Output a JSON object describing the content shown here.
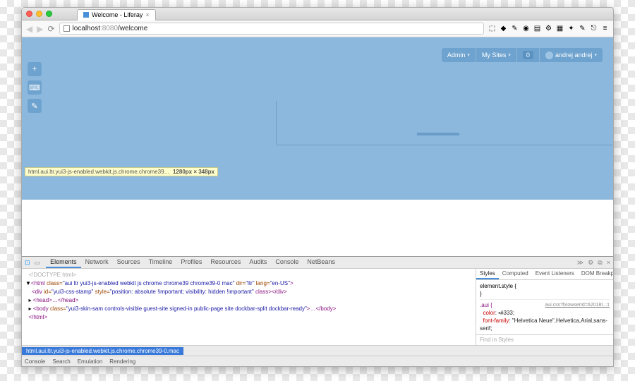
{
  "tab": {
    "title": "Welcome - Liferay"
  },
  "url": {
    "host": "localhost",
    "port": ":8080",
    "path": "/welcome"
  },
  "dockbar": {
    "admin": "Admin",
    "mysites": "My Sites",
    "count": "0",
    "user": "andrej andrej"
  },
  "tooltip": {
    "text": "html.aui.ltr.yui3-js-enabled.webkit.js.chrome.chrome39…",
    "dims": "1280px × 348px"
  },
  "devtools": {
    "tabs": [
      "Elements",
      "Network",
      "Sources",
      "Timeline",
      "Profiles",
      "Resources",
      "Audits",
      "Console",
      "NetBeans"
    ],
    "activeTab": "Elements",
    "stylesTabs": [
      "Styles",
      "Computed",
      "Event Listeners",
      "DOM Breakpoints"
    ],
    "activeStylesTab": "Styles",
    "drawer": [
      "Console",
      "Search",
      "Emulation",
      "Rendering"
    ],
    "crumb": "html.aui.ltr.yui3-js-enabled.webkit.js.chrome.chrome39-0.mac",
    "dom": {
      "l1": "<!DOCTYPE html>",
      "l2a": "<html ",
      "l2b": "class=",
      "l2c": "\"aui ltr yui3-js-enabled webkit js chrome chrome39 chrome39-0 mac\"",
      "l2d": " dir=",
      "l2e": "\"ltr\"",
      "l2f": " lang=",
      "l2g": "\"en-US\"",
      "l2h": ">",
      "l3a": "<div ",
      "l3b": "id=",
      "l3c": "\"yui3-css-stamp\"",
      "l3d": " style=",
      "l3e": "\"position: absolute !important; visibility: hidden !important\"",
      "l3f": " class></div>",
      "l4": "<head>…</head>",
      "l5a": "<body ",
      "l5b": "class=",
      "l5c": "\"yui3-skin-sam controls-visible guest-site signed-in public-page site dockbar-split dockbar-ready\"",
      "l5d": ">…</body>",
      "l6": "</html>"
    },
    "styles": {
      "r1": "element.style {",
      "r1b": "}",
      "r2sel": ".aui {",
      "r2link": "aui.css?browserId=62018t..:1",
      "r2p1k": "color",
      "r2p1v": ": ▪#333;",
      "r2p2k": "font-family",
      "r2p2v": ": \"Helvetica Neue\",Helvetica,Arial,sans-serif;",
      "filter": "Find in Styles"
    }
  }
}
